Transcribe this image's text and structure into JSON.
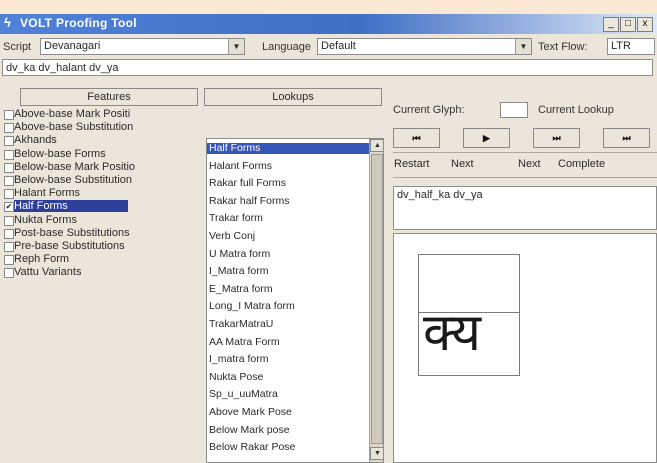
{
  "window": {
    "title": "VOLT Proofing Tool",
    "title_icon": "volt-icon",
    "minimize": "_",
    "maximize": "□",
    "close": "x"
  },
  "toolbar": {
    "script_label": "Script",
    "script_value": "Devanagari",
    "language_label": "Language",
    "language_value": "Default",
    "textflow_label": "Text Flow:",
    "textflow_value": "LTR"
  },
  "input_text": "dv_ka dv_halant dv_ya",
  "features": {
    "header": "Features",
    "items": [
      {
        "label": "Above-base Mark Positi",
        "checked": false
      },
      {
        "label": "Above-base Substitution",
        "checked": false
      },
      {
        "label": "Akhands",
        "checked": false
      },
      {
        "label": "Below-base Forms",
        "checked": false
      },
      {
        "label": "Below-base Mark Positio",
        "checked": false
      },
      {
        "label": "Below-base Substitution",
        "checked": false
      },
      {
        "label": "Halant Forms",
        "checked": false
      },
      {
        "label": "Half Forms",
        "checked": true,
        "selected": true
      },
      {
        "label": "Nukta Forms",
        "checked": false
      },
      {
        "label": "Post-base Substitutions",
        "checked": false
      },
      {
        "label": "Pre-base Substitutions",
        "checked": false
      },
      {
        "label": "Reph Form",
        "checked": false
      },
      {
        "label": "Vattu Variants",
        "checked": false
      }
    ]
  },
  "lookups": {
    "header": "Lookups",
    "items": [
      {
        "label": "Half Forms",
        "selected": true
      },
      {
        "label": "Halant Forms"
      },
      {
        "label": "Rakar full Forms"
      },
      {
        "label": "Rakar half Forms"
      },
      {
        "label": "Trakar form"
      },
      {
        "label": "Verb Conj"
      },
      {
        "label": "U Matra form"
      },
      {
        "label": "I_Matra form"
      },
      {
        "label": "E_Matra form"
      },
      {
        "label": "Long_I Matra form"
      },
      {
        "label": "TrakarMatraU"
      },
      {
        "label": "AA Matra Form"
      },
      {
        "label": "I_matra form"
      },
      {
        "label": "Nukta Pose"
      },
      {
        "label": "Sp_u_uuMatra"
      },
      {
        "label": "Above Mark Pose"
      },
      {
        "label": "Below Mark pose"
      },
      {
        "label": "Below Rakar Pose"
      }
    ]
  },
  "glyph_panel": {
    "current_glyph_label": "Current Glyph:",
    "current_lookup_label": "Current Lookup",
    "nav_buttons": [
      {
        "name": "first-button",
        "symbol": "⏮"
      },
      {
        "name": "play-button",
        "symbol": "▶"
      },
      {
        "name": "fast-forward-button",
        "symbol": "⏭"
      },
      {
        "name": "last-button",
        "symbol": "⏭"
      }
    ],
    "nav_labels": [
      "Restart",
      "Next",
      "Next",
      "Complete"
    ],
    "glyph_sequence": "dv_half_ka dv_ya",
    "rendered_glyph": "क्य"
  }
}
